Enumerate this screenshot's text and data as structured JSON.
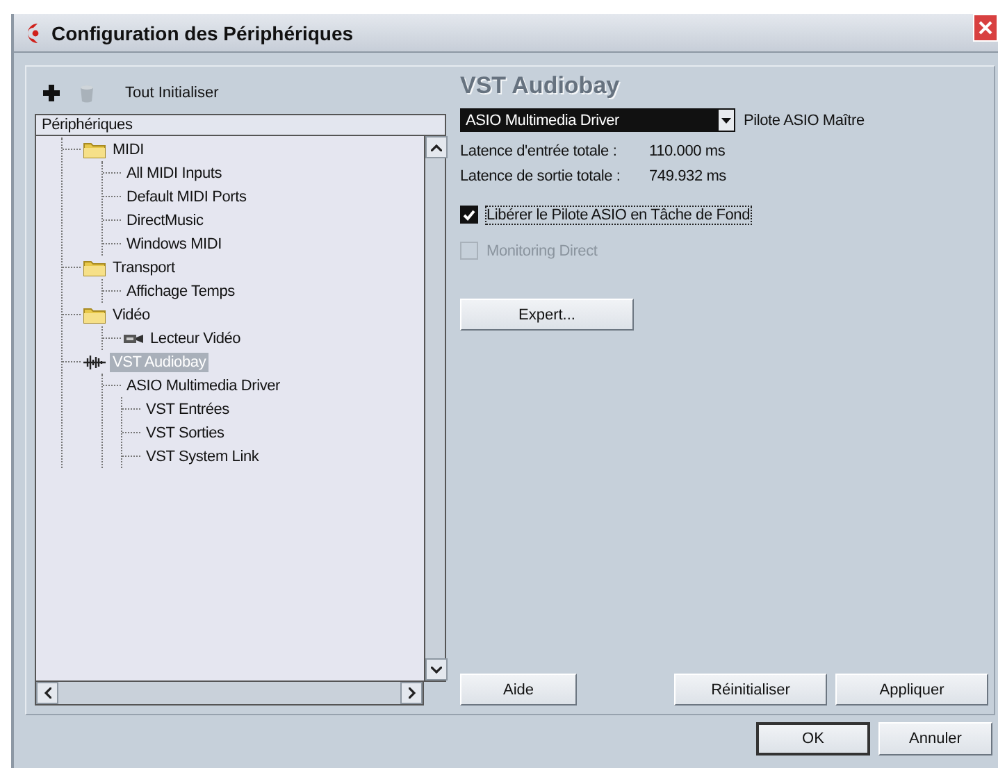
{
  "window": {
    "title": "Configuration des Périphériques"
  },
  "toolbar": {
    "reset_all": "Tout Initialiser"
  },
  "tree": {
    "header": "Périphériques",
    "items": [
      {
        "label": "MIDI",
        "kind": "folder",
        "selected": false,
        "children": [
          {
            "label": "All MIDI Inputs",
            "selected": false
          },
          {
            "label": "Default MIDI Ports",
            "selected": false
          },
          {
            "label": "DirectMusic",
            "selected": false
          },
          {
            "label": "Windows MIDI",
            "selected": false
          }
        ]
      },
      {
        "label": "Transport",
        "kind": "folder",
        "selected": false,
        "children": [
          {
            "label": "Affichage Temps",
            "selected": false
          }
        ]
      },
      {
        "label": "Vidéo",
        "kind": "folder",
        "selected": false,
        "children": [
          {
            "label": "Lecteur Vidéo",
            "kind": "video",
            "selected": false
          }
        ]
      },
      {
        "label": "VST Audiobay",
        "kind": "audio",
        "selected": true,
        "children": [
          {
            "label": "ASIO Multimedia Driver",
            "selected": false,
            "children": [
              {
                "label": "VST Entrées",
                "selected": false
              },
              {
                "label": "VST Sorties",
                "selected": false
              },
              {
                "label": "VST System Link",
                "selected": false
              }
            ]
          }
        ]
      }
    ]
  },
  "panel": {
    "title": "VST Audiobay",
    "driver": {
      "value": "ASIO Multimedia Driver",
      "label": "Pilote ASIO Maître"
    },
    "latencies": [
      {
        "label": "Latence d'entrée totale :",
        "value": "110.000 ms"
      },
      {
        "label": "Latence de sortie totale :",
        "value": "749.932 ms"
      }
    ],
    "options": [
      {
        "label": "Libérer le Pilote ASIO en Tâche de Fond",
        "checked": true,
        "disabled": false
      },
      {
        "label": "Monitoring Direct",
        "checked": false,
        "disabled": true
      }
    ],
    "expert_button": "Expert...",
    "buttons": [
      {
        "label": "Aide",
        "kind": "help"
      },
      {
        "label": "Réinitialiser",
        "kind": "action"
      },
      {
        "label": "Appliquer",
        "kind": "action"
      }
    ]
  },
  "dialog_buttons": [
    {
      "label": "OK",
      "default": true
    },
    {
      "label": "Annuler",
      "default": false
    }
  ]
}
